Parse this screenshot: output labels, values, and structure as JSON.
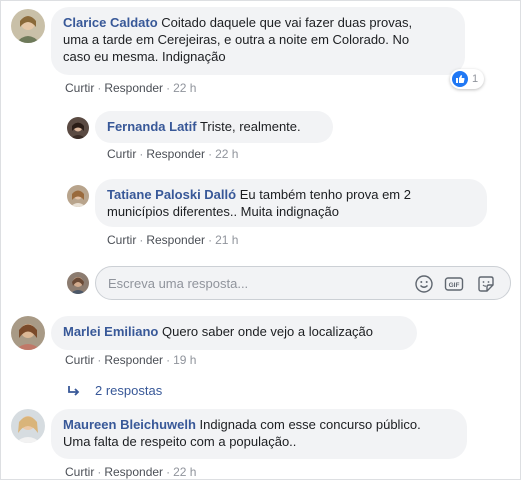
{
  "actions": {
    "like": "Curtir",
    "reply": "Responder",
    "separator": "·"
  },
  "comments": [
    {
      "author": "Clarice Caldato",
      "line1": "Coitado daquele que vai fazer duas provas,",
      "line2": "uma a tarde em Cerejeiras, e outra a noite em Colorado. No",
      "line3": "caso eu mesma. Indignação",
      "time": "22 h",
      "reaction_count": "1"
    },
    {
      "author": "Marlei Emiliano",
      "line1": "Quero saber onde vejo a localização",
      "time": "19 h",
      "replies_label": "2 respostas"
    },
    {
      "author": "Maureen Bleichuwelh",
      "line1": "Indignada com esse concurso público.",
      "line2": "Uma falta de respeito com a população..",
      "time": "22 h"
    }
  ],
  "replies": [
    {
      "author": "Fernanda Latif",
      "line1": "Triste, realmente.",
      "time": "22 h"
    },
    {
      "author": "Tatiane Paloski Dalló",
      "line1": "Eu também tenho prova em 2",
      "line2": "municípios diferentes.. Muita indignação",
      "time": "21 h"
    }
  ],
  "reply_box": {
    "placeholder": "Escreva uma resposta...",
    "icons": [
      "emoji-icon",
      "gif-icon",
      "sticker-icon"
    ]
  },
  "colors": {
    "name": "#385898",
    "bubble": "#f2f3f5",
    "meta": "#90949c",
    "like_blue": "#2078f4"
  }
}
